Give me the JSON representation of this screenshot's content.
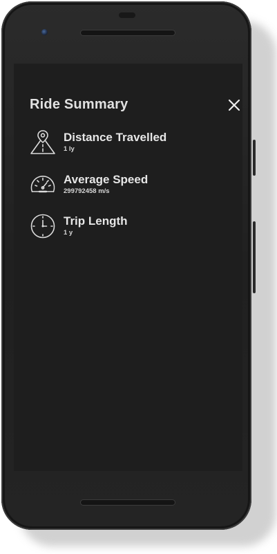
{
  "panel": {
    "title": "Ride Summary",
    "close_icon": "close-icon"
  },
  "stats": [
    {
      "label": "Distance Travelled",
      "value": "1 ly",
      "icon": "road-pin-icon"
    },
    {
      "label": "Average Speed",
      "value": "299792458 m/s",
      "icon": "speedometer-icon"
    },
    {
      "label": "Trip Length",
      "value": "1 y",
      "icon": "clock-icon"
    }
  ],
  "colors": {
    "screen_background": "#1e1e1e",
    "text_primary": "#e2e2e2",
    "phone_body": "#252525"
  }
}
